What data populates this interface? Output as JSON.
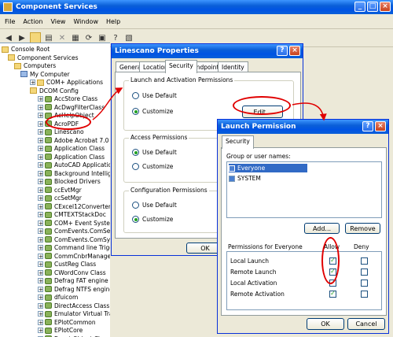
{
  "main_window": {
    "title": "Component Services",
    "menu": [
      "File",
      "Action",
      "View",
      "Window",
      "Help"
    ],
    "tree": [
      {
        "label": "Console Root",
        "icon": "folder"
      },
      {
        "label": "Component Services",
        "icon": "folder"
      },
      {
        "label": "Computers",
        "icon": "folder"
      },
      {
        "label": "My Computer",
        "icon": "computer"
      },
      {
        "label": "COM+ Applications",
        "icon": "folder"
      },
      {
        "label": "DCOM Config",
        "icon": "folder"
      },
      {
        "label": "AccStore Class",
        "icon": "gear"
      },
      {
        "label": "AcDwgFilterClass",
        "icon": "gear"
      },
      {
        "label": "AcHelpObject",
        "icon": "gear"
      },
      {
        "label": "AcroPDF",
        "icon": "gear"
      },
      {
        "label": "Linescano",
        "icon": "gear"
      },
      {
        "label": "Adobe Acrobat 7.0 Doc",
        "icon": "gear"
      },
      {
        "label": "Application Class",
        "icon": "gear"
      },
      {
        "label": "Application Class",
        "icon": "gear"
      },
      {
        "label": "AutoCAD Application",
        "icon": "gear"
      },
      {
        "label": "Background Intelligent",
        "icon": "gear"
      },
      {
        "label": "Blocked Drivers",
        "icon": "gear"
      },
      {
        "label": "ccEvtMgr",
        "icon": "gear"
      },
      {
        "label": "ccSetMgr",
        "icon": "gear"
      },
      {
        "label": "CExcel12Converter Cl",
        "icon": "gear"
      },
      {
        "label": "CMTEXTStackDoc",
        "icon": "gear"
      },
      {
        "label": "COM+ Event System",
        "icon": "gear"
      },
      {
        "label": "ComEvents.ComServi",
        "icon": "gear"
      },
      {
        "label": "ComEvents.ComSyste",
        "icon": "gear"
      },
      {
        "label": "Command line Trigger",
        "icon": "gear"
      },
      {
        "label": "CommCnbrManager",
        "icon": "gear"
      },
      {
        "label": "CustReg Class",
        "icon": "gear"
      },
      {
        "label": "CWordConv Class",
        "icon": "gear"
      },
      {
        "label": "Defrag FAT engine",
        "icon": "gear"
      },
      {
        "label": "Defrag NTFS engine",
        "icon": "gear"
      },
      {
        "label": "dfuicom",
        "icon": "gear"
      },
      {
        "label": "DirectAccess Class",
        "icon": "gear"
      },
      {
        "label": "Emulator Virtual Trans",
        "icon": "gear"
      },
      {
        "label": "EPlotCommon",
        "icon": "gear"
      },
      {
        "label": "EPlotCore",
        "icon": "gear"
      },
      {
        "label": "Event Object Change",
        "icon": "gear"
      }
    ]
  },
  "properties_dialog": {
    "title": "Linescano Properties",
    "tabs": [
      "General",
      "Location",
      "Security",
      "Endpoints",
      "Identity"
    ],
    "active_tab": "Security",
    "launch_group": {
      "label": "Launch and Activation Permissions",
      "use_default": "Use Default",
      "customize": "Customize",
      "edit": "Edit..."
    },
    "access_group": {
      "label": "Access Permissions",
      "use_default": "Use Default",
      "customize": "Customize"
    },
    "config_group": {
      "label": "Configuration Permissions",
      "use_default": "Use Default",
      "customize": "Customize"
    },
    "ok": "OK"
  },
  "launch_dialog": {
    "title": "Launch Permission",
    "tab": "Security",
    "group_label": "Group or user names:",
    "users": [
      "Everyone",
      "SYSTEM"
    ],
    "add": "Add...",
    "remove": "Remove",
    "perm_header": "Permissions for Everyone",
    "allow": "Allow",
    "deny": "Deny",
    "permissions": [
      {
        "name": "Local Launch",
        "allow": true,
        "deny": false
      },
      {
        "name": "Remote Launch",
        "allow": true,
        "deny": false
      },
      {
        "name": "Local Activation",
        "allow": true,
        "deny": false
      },
      {
        "name": "Remote Activation",
        "allow": true,
        "deny": false
      }
    ],
    "ok": "OK",
    "cancel": "Cancel"
  },
  "colors": {
    "highlight": "#e00000",
    "xp_blue": "#0054e3",
    "selected": "#316ac5"
  }
}
